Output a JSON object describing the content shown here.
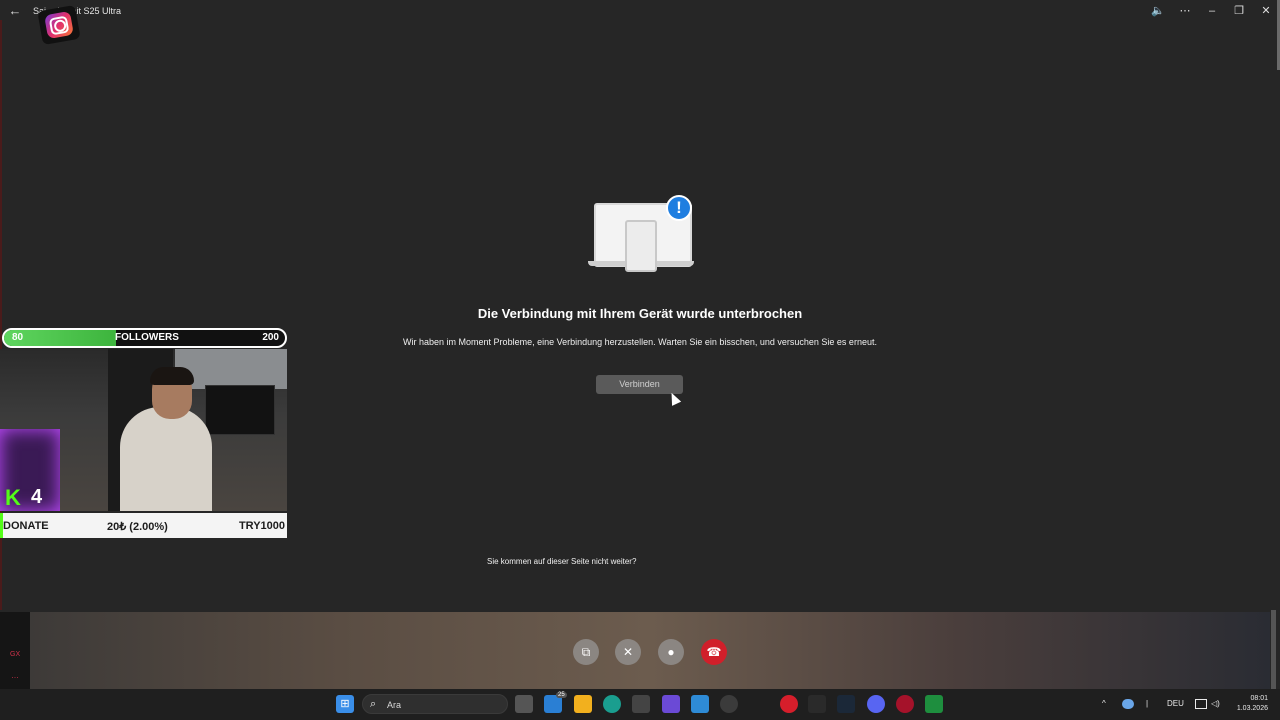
{
  "window": {
    "title": "Sai… iye ait S25 Ultra",
    "back_glyph": "←",
    "controls": [
      "speaker-icon",
      "more-icon",
      "minimize-icon",
      "maximize-icon",
      "close-icon"
    ]
  },
  "error": {
    "heading": "Die Verbindung mit Ihrem Gerät wurde unterbrochen",
    "message": "Wir haben im Moment Probleme, eine Verbindung herzustellen. Warten Sie ein bisschen, und versuchen Sie es erneut.",
    "connect_label": "Verbinden",
    "help_text": "Sie kommen auf dieser Seite nicht weiter?",
    "badge_glyph": "!"
  },
  "stream_overlay": {
    "followers": {
      "current": "80",
      "label": "FOLLOWERS",
      "goal": "200",
      "progress": 0.4
    },
    "kick_letter": "K",
    "kick_count": "4",
    "donate": {
      "label": "DONATE",
      "amount": "20₺ (2.00%)",
      "goal": "TRY1000"
    },
    "accent": "#53fc18"
  },
  "side": {
    "gx": "GX",
    "dots": "…"
  },
  "call_controls": [
    {
      "name": "screen-share-icon",
      "glyph": "⧉"
    },
    {
      "name": "camera-off-icon",
      "glyph": "✕"
    },
    {
      "name": "microphone-icon",
      "glyph": "●"
    },
    {
      "name": "end-call-icon",
      "glyph": "☎"
    }
  ],
  "taskbar": {
    "search_placeholder": "Ara",
    "badge": "25",
    "language": "DEU",
    "time": "08:01",
    "date": "1.03.2026"
  },
  "colors": {
    "end_call": "#d11f2a",
    "alert_blue": "#1f7ee0",
    "kick_green": "#53fc18"
  }
}
